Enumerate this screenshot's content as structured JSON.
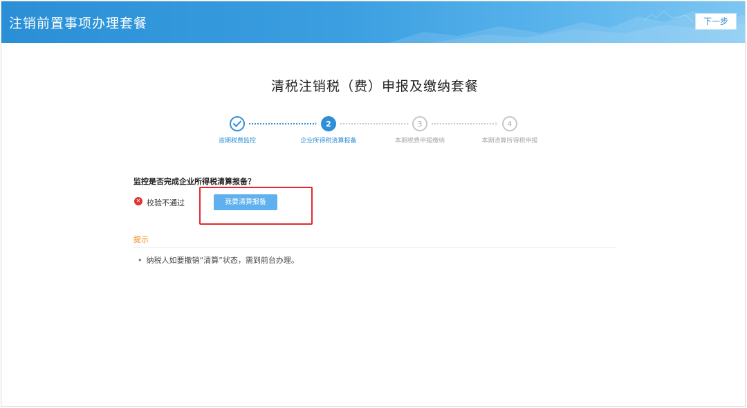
{
  "header": {
    "title": "注销前置事项办理套餐",
    "next_button": "下一步",
    "colors": {
      "banner": "#2a8fd6"
    }
  },
  "page": {
    "heading": "清税注销税（费）申报及缴纳套餐"
  },
  "stepper": {
    "steps": [
      {
        "number": "",
        "label": "逾期税费监控",
        "state": "done",
        "icon": "check-icon"
      },
      {
        "number": "2",
        "label": "企业所得税清算报备",
        "state": "active"
      },
      {
        "number": "3",
        "label": "本期税费申报缴纳",
        "state": "todo"
      },
      {
        "number": "4",
        "label": "本期清算所得税申报",
        "state": "todo"
      }
    ],
    "colors": {
      "active": "#2e8fd6",
      "inactive": "#c6c6c6"
    }
  },
  "check": {
    "question": "监控是否完成企业所得税清算报备？",
    "status_icon": "error-icon",
    "status_text": "校验不通过",
    "action_button": "我要清算报备",
    "colors": {
      "error": "#e2322f",
      "button": "#5fb0ef",
      "highlight": "#e0282e"
    }
  },
  "tips": {
    "title": "提示",
    "items": [
      "纳税人如要撤销“清算”状态，需到前台办理。"
    ],
    "colors": {
      "title": "#f08a1c"
    }
  }
}
